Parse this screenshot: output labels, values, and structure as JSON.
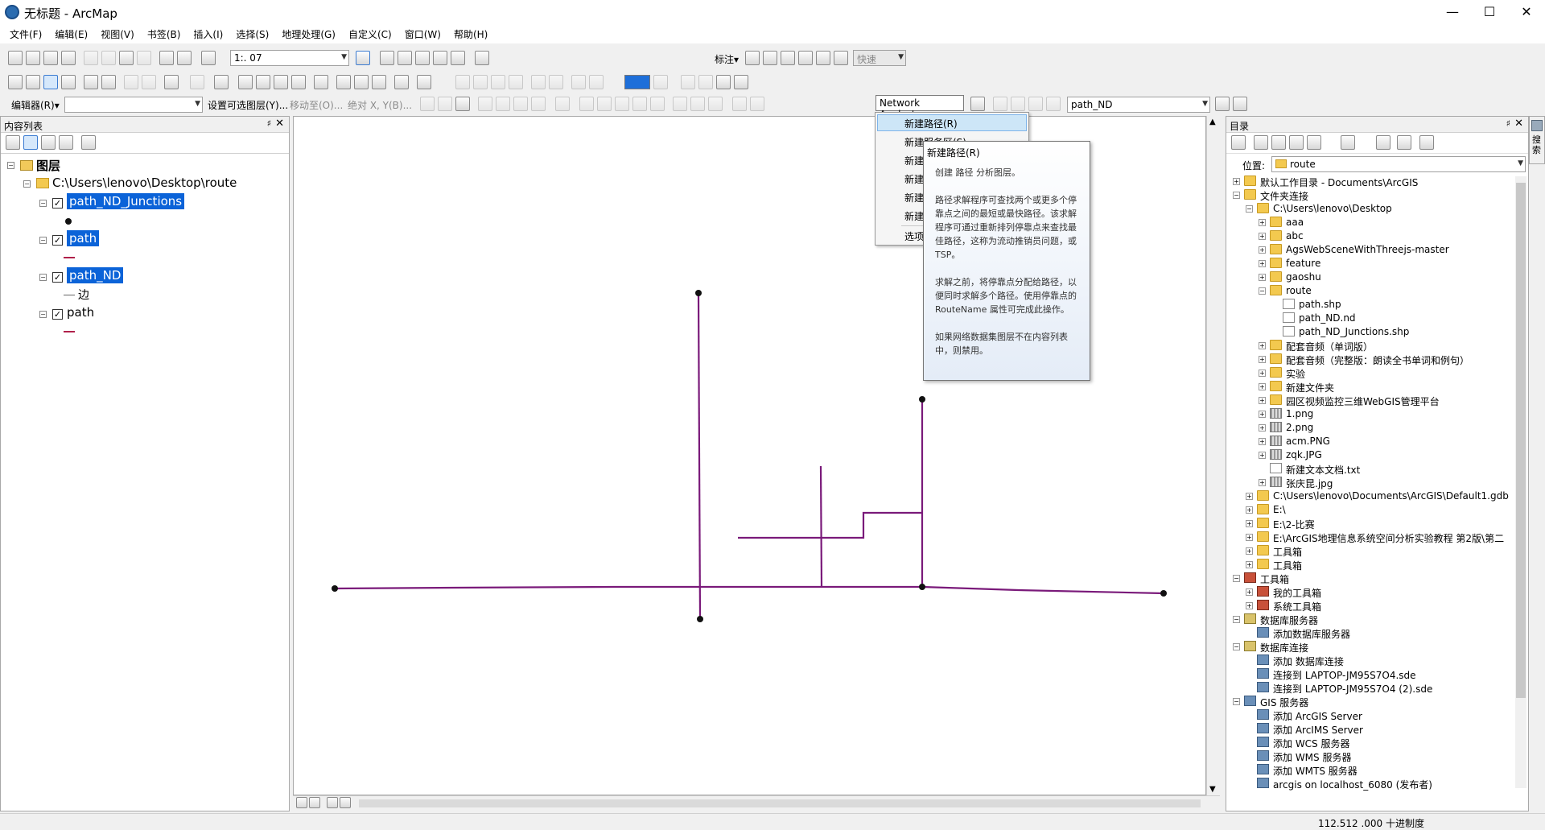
{
  "window": {
    "title": "无标题 - ArcMap",
    "minimize": "—",
    "maximize": "☐",
    "close": "✕"
  },
  "menu": [
    "文件(F)",
    "编辑(E)",
    "视图(V)",
    "书签(B)",
    "插入(I)",
    "选择(S)",
    "地理处理(G)",
    "自定义(C)",
    "窗口(W)",
    "帮助(H)"
  ],
  "toolbar": {
    "scale": "1:. 07",
    "label_menu": "标注▾",
    "quick": "快速",
    "editor": "编辑器(R)▾",
    "set_selectable": "设置可选图层(Y)...",
    "move_to": "移动至(O)...",
    "absolute_xy": "绝对 X, Y(B)...",
    "network_analyst": "Network Analyst▾",
    "network_dataset": "path_ND"
  },
  "toc": {
    "title": "内容列表",
    "layers_root": "图层",
    "folder": "C:\\Users\\lenovo\\Desktop\\route",
    "layers": [
      {
        "name": "path_ND_Junctions",
        "selected": true,
        "checked": true
      },
      {
        "name": "path",
        "selected": true,
        "checked": true
      },
      {
        "name": "path_ND",
        "selected": true,
        "checked": true,
        "sub": "边"
      },
      {
        "name": "path",
        "selected": false,
        "checked": true
      }
    ]
  },
  "dropdown": {
    "items": [
      "新建路径(R)",
      "新建服务区(S)",
      "新建",
      "新建",
      "新建",
      "新建",
      "选项"
    ],
    "highlight": "新建路径(R)"
  },
  "tooltip": {
    "title": "新建路径(R)",
    "body": "创建 路径 分析图层。\n\n路径求解程序可查找两个或更多个停靠点之间的最短或最快路径。该求解程序可通过重新排列停靠点来查找最佳路径，这称为流动推销员问题，或 TSP。\n\n求解之前，将停靠点分配给路径，以便同时求解多个路径。使用停靠点的 RouteName 属性可完成此操作。\n\n如果网络数据集图层不在内容列表中，则禁用。"
  },
  "catalog": {
    "title": "目录",
    "location_label": "位置:",
    "location_value": "route",
    "tree": [
      {
        "label": "默认工作目录 - Documents\\ArcGIS",
        "level": 0,
        "icon": "home-folder-icon",
        "exp": "+"
      },
      {
        "label": "文件夹连接",
        "level": 0,
        "icon": "folder-connections-icon",
        "exp": "-"
      },
      {
        "label": "C:\\Users\\lenovo\\Desktop",
        "level": 1,
        "icon": "folder-icon",
        "exp": "-"
      },
      {
        "label": "aaa",
        "level": 2,
        "icon": "folder-icon",
        "exp": "+"
      },
      {
        "label": "abc",
        "level": 2,
        "icon": "folder-icon",
        "exp": "+"
      },
      {
        "label": "AgsWebSceneWithThreejs-master",
        "level": 2,
        "icon": "folder-icon",
        "exp": "+"
      },
      {
        "label": "feature",
        "level": 2,
        "icon": "folder-icon",
        "exp": "+"
      },
      {
        "label": "gaoshu",
        "level": 2,
        "icon": "folder-icon",
        "exp": "+"
      },
      {
        "label": "route",
        "level": 2,
        "icon": "folder-icon",
        "exp": "-"
      },
      {
        "label": "path.shp",
        "level": 3,
        "icon": "shapefile-icon",
        "exp": ""
      },
      {
        "label": "path_ND.nd",
        "level": 3,
        "icon": "network-dataset-icon",
        "exp": ""
      },
      {
        "label": "path_ND_Junctions.shp",
        "level": 3,
        "icon": "shapefile-icon",
        "exp": ""
      },
      {
        "label": "配套音频（单词版）",
        "level": 2,
        "icon": "folder-icon",
        "exp": "+"
      },
      {
        "label": "配套音频（完整版：朗读全书单词和例句）",
        "level": 2,
        "icon": "folder-icon",
        "exp": "+"
      },
      {
        "label": "实验",
        "level": 2,
        "icon": "folder-icon",
        "exp": "+"
      },
      {
        "label": "新建文件夹",
        "level": 2,
        "icon": "folder-icon",
        "exp": "+"
      },
      {
        "label": "园区视频监控三维WebGIS管理平台",
        "level": 2,
        "icon": "folder-icon",
        "exp": "+"
      },
      {
        "label": "1.png",
        "level": 2,
        "icon": "raster-icon",
        "exp": "+"
      },
      {
        "label": "2.png",
        "level": 2,
        "icon": "raster-icon",
        "exp": "+"
      },
      {
        "label": "acm.PNG",
        "level": 2,
        "icon": "raster-icon",
        "exp": "+"
      },
      {
        "label": "zqk.JPG",
        "level": 2,
        "icon": "raster-icon",
        "exp": "+"
      },
      {
        "label": "新建文本文档.txt",
        "level": 2,
        "icon": "text-file-icon",
        "exp": ""
      },
      {
        "label": "张庆昆.jpg",
        "level": 2,
        "icon": "raster-icon",
        "exp": "+"
      },
      {
        "label": "C:\\Users\\lenovo\\Documents\\ArcGIS\\Default1.gdb",
        "level": 1,
        "icon": "folder-icon",
        "exp": "+"
      },
      {
        "label": "E:\\",
        "level": 1,
        "icon": "folder-icon",
        "exp": "+"
      },
      {
        "label": "E:\\2-比赛",
        "level": 1,
        "icon": "folder-icon",
        "exp": "+"
      },
      {
        "label": "E:\\ArcGIS地理信息系统空间分析实验教程 第2版\\第二",
        "level": 1,
        "icon": "folder-icon",
        "exp": "+"
      },
      {
        "label": "工具箱",
        "level": 1,
        "icon": "folder-icon",
        "exp": "+"
      },
      {
        "label": "工具箱",
        "level": 1,
        "icon": "folder-icon",
        "exp": "+"
      },
      {
        "label": "工具箱",
        "level": 0,
        "icon": "toolbox-icon",
        "exp": "-"
      },
      {
        "label": "我的工具箱",
        "level": 1,
        "icon": "toolbox-icon",
        "exp": "+"
      },
      {
        "label": "系统工具箱",
        "level": 1,
        "icon": "toolbox-icon",
        "exp": "+"
      },
      {
        "label": "数据库服务器",
        "level": 0,
        "icon": "database-server-icon",
        "exp": "-"
      },
      {
        "label": "添加数据库服务器",
        "level": 1,
        "icon": "add-server-icon",
        "exp": ""
      },
      {
        "label": "数据库连接",
        "level": 0,
        "icon": "database-connections-icon",
        "exp": "-"
      },
      {
        "label": "添加 数据库连接",
        "level": 1,
        "icon": "add-connection-icon",
        "exp": ""
      },
      {
        "label": "连接到 LAPTOP-JM95S7O4.sde",
        "level": 1,
        "icon": "sde-icon",
        "exp": ""
      },
      {
        "label": "连接到 LAPTOP-JM95S7O4 (2).sde",
        "level": 1,
        "icon": "sde-icon",
        "exp": ""
      },
      {
        "label": "GIS 服务器",
        "level": 0,
        "icon": "gis-server-icon",
        "exp": "-"
      },
      {
        "label": "添加 ArcGIS Server",
        "level": 1,
        "icon": "add-server-icon",
        "exp": ""
      },
      {
        "label": "添加 ArcIMS Server",
        "level": 1,
        "icon": "add-server-icon",
        "exp": ""
      },
      {
        "label": "添加 WCS 服务器",
        "level": 1,
        "icon": "add-server-icon",
        "exp": ""
      },
      {
        "label": "添加 WMS 服务器",
        "level": 1,
        "icon": "add-server-icon",
        "exp": ""
      },
      {
        "label": "添加 WMTS 服务器",
        "level": 1,
        "icon": "add-server-icon",
        "exp": ""
      },
      {
        "label": "arcgis on localhost_6080 (发布者)",
        "level": 1,
        "icon": "server-connection-icon",
        "exp": ""
      }
    ]
  },
  "side_tab": "搜索",
  "status": {
    "coords": "112.512  .000 十进制度"
  },
  "colors": {
    "path": "#7a1a7a",
    "selection": "#0b63d8",
    "menu_highlight": "#cde6f7"
  }
}
